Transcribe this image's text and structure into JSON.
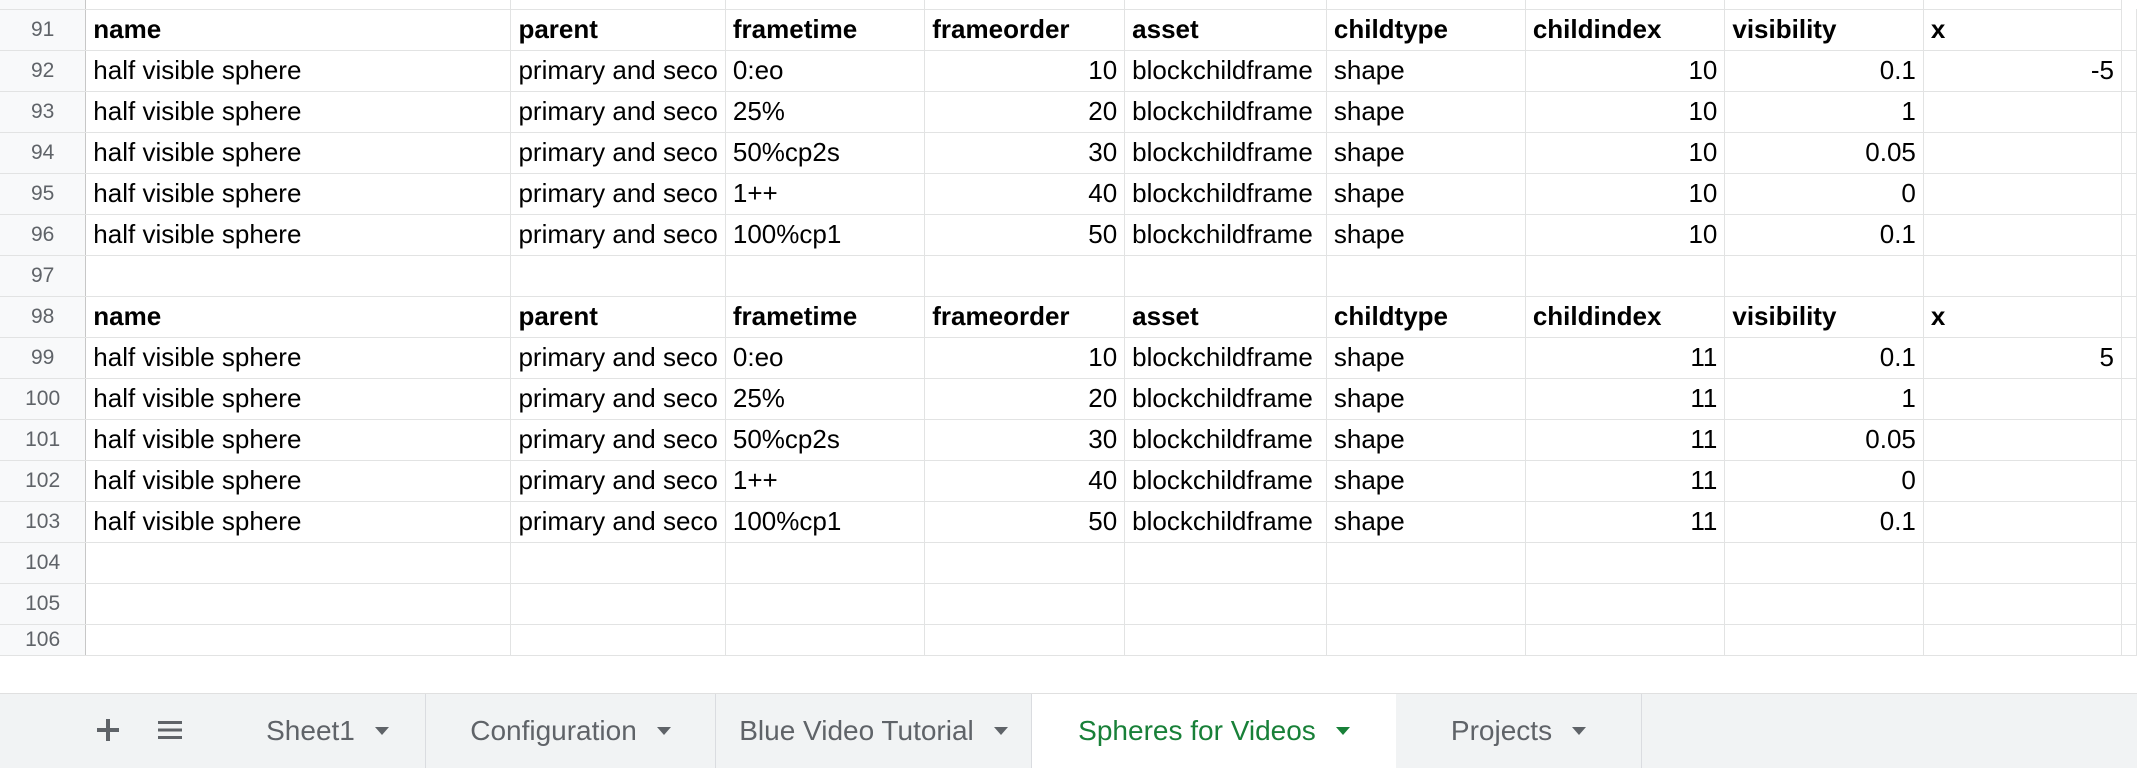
{
  "spreadsheet": {
    "header_labels": [
      "name",
      "parent",
      "frametime",
      "frameorder",
      "asset",
      "childtype",
      "childindex",
      "visibility",
      "x"
    ],
    "rows": [
      {
        "num": "91",
        "hdr": true
      },
      {
        "num": "92",
        "cells": [
          "half visible sphere",
          "primary and seco",
          "0:eo",
          "10",
          "blockchildframe",
          "shape",
          "10",
          "0.1",
          "-5"
        ]
      },
      {
        "num": "93",
        "cells": [
          "half visible sphere",
          "primary and seco",
          "25%",
          "20",
          "blockchildframe",
          "shape",
          "10",
          "1",
          ""
        ]
      },
      {
        "num": "94",
        "cells": [
          "half visible sphere",
          "primary and seco",
          "50%cp2s",
          "30",
          "blockchildframe",
          "shape",
          "10",
          "0.05",
          ""
        ]
      },
      {
        "num": "95",
        "cells": [
          "half visible sphere",
          "primary and seco",
          "1++",
          "40",
          "blockchildframe",
          "shape",
          "10",
          "0",
          ""
        ]
      },
      {
        "num": "96",
        "cells": [
          "half visible sphere",
          "primary and seco",
          "100%cp1",
          "50",
          "blockchildframe",
          "shape",
          "10",
          "0.1",
          ""
        ]
      },
      {
        "num": "97",
        "cells": [
          "",
          "",
          "",
          "",
          "",
          "",
          "",
          "",
          ""
        ]
      },
      {
        "num": "98",
        "hdr": true
      },
      {
        "num": "99",
        "cells": [
          "half visible sphere",
          "primary and seco",
          "0:eo",
          "10",
          "blockchildframe",
          "shape",
          "11",
          "0.1",
          "5"
        ]
      },
      {
        "num": "100",
        "cells": [
          "half visible sphere",
          "primary and seco",
          "25%",
          "20",
          "blockchildframe",
          "shape",
          "11",
          "1",
          ""
        ]
      },
      {
        "num": "101",
        "cells": [
          "half visible sphere",
          "primary and seco",
          "50%cp2s",
          "30",
          "blockchildframe",
          "shape",
          "11",
          "0.05",
          ""
        ]
      },
      {
        "num": "102",
        "cells": [
          "half visible sphere",
          "primary and seco",
          "1++",
          "40",
          "blockchildframe",
          "shape",
          "11",
          "0",
          ""
        ]
      },
      {
        "num": "103",
        "cells": [
          "half visible sphere",
          "primary and seco",
          "100%cp1",
          "50",
          "blockchildframe",
          "shape",
          "11",
          "0.1",
          ""
        ]
      },
      {
        "num": "104",
        "cells": [
          "",
          "",
          "",
          "",
          "",
          "",
          "",
          "",
          ""
        ]
      },
      {
        "num": "105",
        "cells": [
          "",
          "",
          "",
          "",
          "",
          "",
          "",
          "",
          ""
        ]
      },
      {
        "num": "106",
        "cells": [
          "",
          "",
          "",
          "",
          "",
          "",
          "",
          "",
          ""
        ]
      }
    ]
  },
  "tabs": {
    "add_icon": "plus-icon",
    "list_icon": "sheet-list-icon",
    "items": [
      {
        "label": "Sheet1",
        "active": false
      },
      {
        "label": "Configuration",
        "active": false
      },
      {
        "label": "Blue Video Tutorial",
        "active": false
      },
      {
        "label": "Spheres for Videos",
        "active": true
      },
      {
        "label": "Projects",
        "active": false
      }
    ],
    "active_color": "#188038"
  }
}
